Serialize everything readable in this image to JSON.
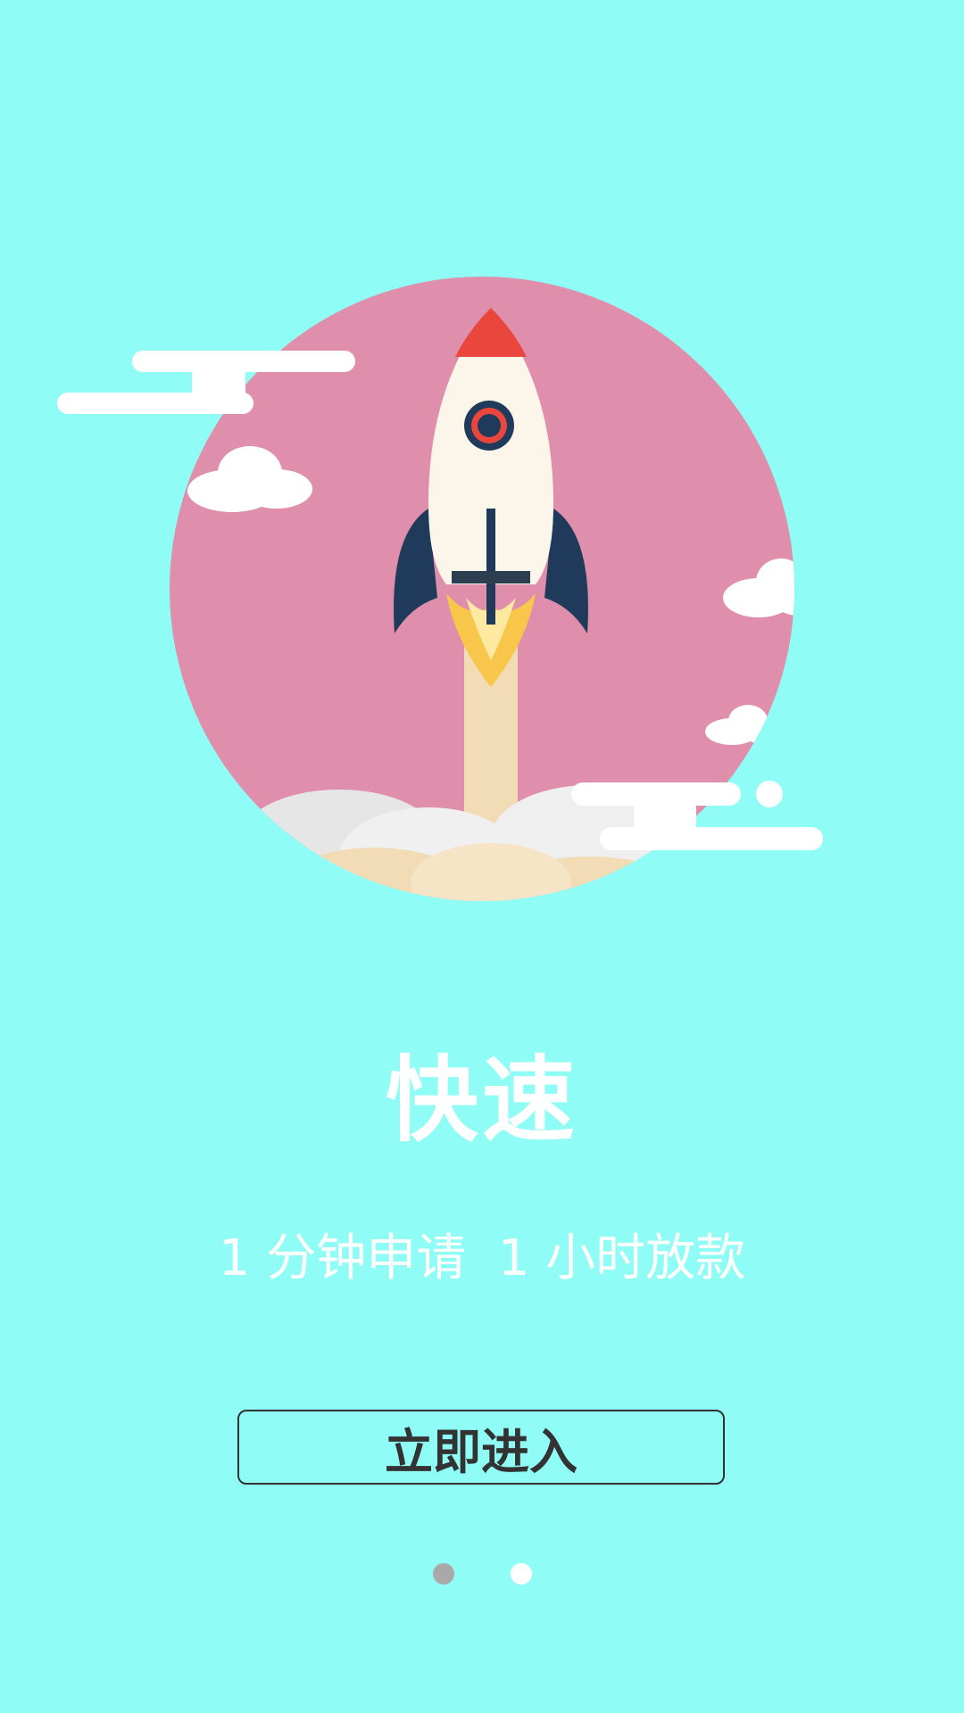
{
  "hero": {
    "icon": "rocket-launch-illustration",
    "circle_color": "#df8fab"
  },
  "title": "快速",
  "subtitle": "1 分钟申请  1 小时放款",
  "enter_button_label": "立即进入",
  "pager": {
    "total": 2,
    "active_index": 1
  },
  "colors": {
    "background": "#8ffcf6",
    "text": "#ffffff",
    "button_text": "#333333"
  }
}
